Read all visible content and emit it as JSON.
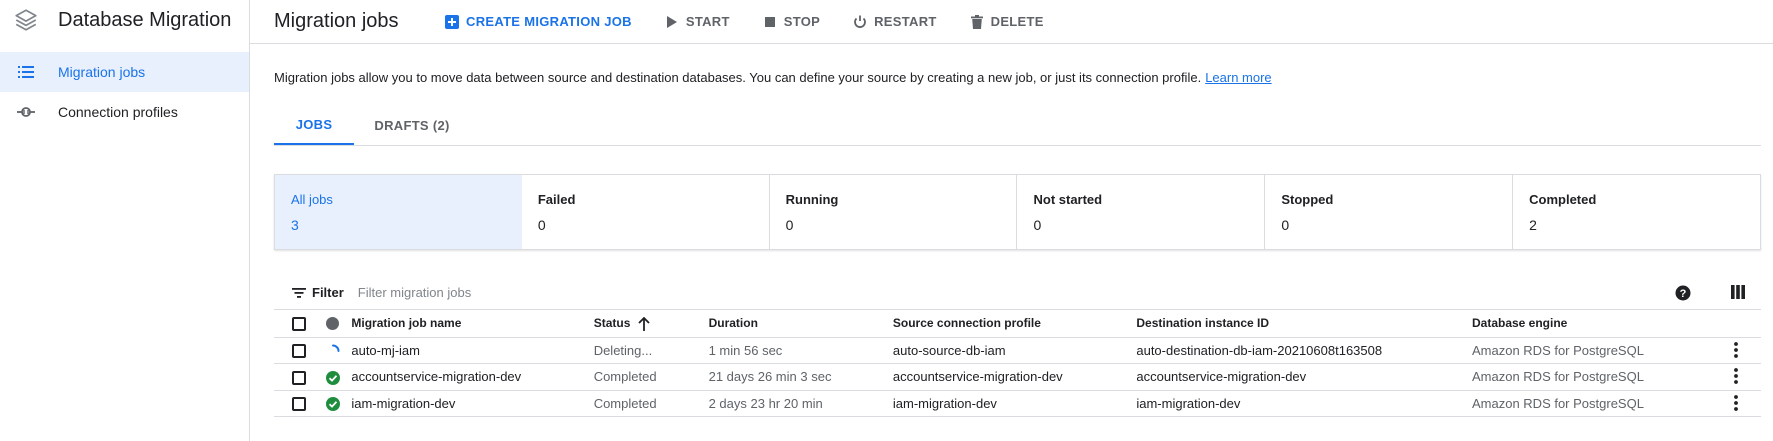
{
  "sidebar": {
    "product_title": "Database Migration",
    "product_icon": "layers-icon",
    "items": [
      {
        "label": "Migration jobs",
        "icon": "list-icon",
        "active": true
      },
      {
        "label": "Connection profiles",
        "icon": "connection-icon",
        "active": false
      }
    ]
  },
  "header": {
    "title": "Migration jobs",
    "actions": {
      "create": "CREATE MIGRATION JOB",
      "start": "START",
      "stop": "STOP",
      "restart": "RESTART",
      "delete": "DELETE"
    }
  },
  "intro": {
    "text": "Migration jobs allow you to move data between source and destination databases. You can define your source by creating a new job, or just its connection profile.",
    "link": "Learn more"
  },
  "tabs": [
    {
      "label": "JOBS",
      "active": true
    },
    {
      "label": "DRAFTS (2)",
      "active": false
    }
  ],
  "summary": [
    {
      "label": "All jobs",
      "value": "3"
    },
    {
      "label": "Failed",
      "value": "0"
    },
    {
      "label": "Running",
      "value": "0"
    },
    {
      "label": "Not started",
      "value": "0"
    },
    {
      "label": "Stopped",
      "value": "0"
    },
    {
      "label": "Completed",
      "value": "2"
    }
  ],
  "filter": {
    "label": "Filter",
    "placeholder": "Filter migration jobs"
  },
  "table": {
    "columns": {
      "name": "Migration job name",
      "status": "Status",
      "duration": "Duration",
      "source": "Source connection profile",
      "destination": "Destination instance ID",
      "engine": "Database engine"
    },
    "rows": [
      {
        "status_icon": "spinner-icon",
        "name": "auto-mj-iam",
        "status": "Deleting...",
        "duration": "1 min 56 sec",
        "source": "auto-source-db-iam",
        "destination": "auto-destination-db-iam-20210608t163508",
        "engine": "Amazon RDS for PostgreSQL"
      },
      {
        "status_icon": "check-circle-icon",
        "name": "accountservice-migration-dev",
        "status": "Completed",
        "duration": "21 days 26 min 3 sec",
        "source": "accountservice-migration-dev",
        "destination": "accountservice-migration-dev",
        "engine": "Amazon RDS for PostgreSQL"
      },
      {
        "status_icon": "check-circle-icon",
        "name": "iam-migration-dev",
        "status": "Completed",
        "duration": "2 days 23 hr 20 min",
        "source": "iam-migration-dev",
        "destination": "iam-migration-dev",
        "engine": "Amazon RDS for PostgreSQL"
      }
    ]
  },
  "colors": {
    "accent": "#1a73e8",
    "active_bg": "#e8f0fe",
    "success": "#1e8e3e",
    "border": "#dadce0",
    "muted_text": "#5f6368"
  }
}
